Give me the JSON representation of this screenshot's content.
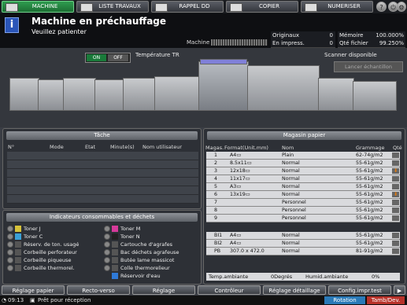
{
  "tabs": [
    {
      "label": "MACHINE",
      "icon": "machine-icon",
      "active": true
    },
    {
      "label": "LISTE TRAVAUX",
      "icon": "job-list-icon"
    },
    {
      "label": "RAPPEL DD",
      "icon": "hdd-recall-icon"
    },
    {
      "label": "COPIER",
      "icon": "copier-icon"
    },
    {
      "label": "NUMERISER",
      "icon": "scanner-icon"
    }
  ],
  "top_right": {
    "help": "?",
    "power": "⏻",
    "settings": "⚙"
  },
  "header": {
    "title": "Machine en préchauffage",
    "subtitle": "Veuillez patienter",
    "machine_label": "Machine",
    "stats": [
      {
        "label": "Originaux",
        "value": "0",
        "label2": "Mémoire",
        "value2": "100.000%"
      },
      {
        "label": "En impress.",
        "value": "0",
        "label2": "Qté fichier",
        "value2": "99.250%"
      }
    ]
  },
  "machine_area": {
    "on": "ON",
    "off": "OFF",
    "temp_label": "Température TR",
    "scanner_status": "Scanner disponible",
    "lancer_label": "Lancer échantillon"
  },
  "tache": {
    "title": "Tâche",
    "columns": [
      "N°",
      "Mode",
      "Etat",
      "Minute(s)",
      "Nom utilisateur"
    ]
  },
  "consumables": {
    "title": "Indicateurs consommables et déchets",
    "left": [
      "Toner J",
      "Toner C",
      "Réserv. de ton. usagé",
      "Corbeille perforateur",
      "Corbeille piqueuse",
      "Corbeille thermorel."
    ],
    "right": [
      "Toner M",
      "Toner N",
      "Cartouche d'agrafes",
      "Bac déchets agrafeuse",
      "Butée lame massicot",
      "Colle thermorelieur",
      "Réservoir d'eau"
    ]
  },
  "paper": {
    "title": "Magasin papier",
    "columns": [
      "Magas.",
      "Format(Unit.mm)",
      "Nom",
      "Grammage",
      "Qté"
    ],
    "trays": [
      {
        "num": "1",
        "format": "A4▭",
        "name": "Plain",
        "gram": "62-74g/m2",
        "alert": false
      },
      {
        "num": "2",
        "format": "8.5x11▭",
        "name": "Normal",
        "gram": "55-61g/m2",
        "alert": false
      },
      {
        "num": "3",
        "format": "12x18▭",
        "name": "Normal",
        "gram": "55-61g/m2",
        "alert": true
      },
      {
        "num": "4",
        "format": "11x17▭",
        "name": "Normal",
        "gram": "55-61g/m2",
        "alert": false
      },
      {
        "num": "5",
        "format": "A3▭",
        "name": "Normal",
        "gram": "55-61g/m2",
        "alert": false
      },
      {
        "num": "6",
        "format": "13x19▭",
        "name": "Normal",
        "gram": "55-61g/m2",
        "alert": true
      },
      {
        "num": "7",
        "format": "",
        "name": "Personnel",
        "gram": "55-61g/m2",
        "alert": false
      },
      {
        "num": "8",
        "format": "",
        "name": "Personnel",
        "gram": "55-61g/m2",
        "alert": false
      },
      {
        "num": "9",
        "format": "",
        "name": "Personnel",
        "gram": "55-61g/m2",
        "alert": false
      }
    ],
    "bypass": [
      {
        "num": "BI1",
        "format": "A4▭",
        "name": "Normal",
        "gram": "55-61g/m2"
      },
      {
        "num": "BI2",
        "format": "A4▭",
        "name": "Normal",
        "gram": "55-61g/m2"
      },
      {
        "num": "PB",
        "format": "307.0 x 472.0",
        "name": "Normal",
        "gram": "81-91g/m2"
      }
    ],
    "temp_label": "Temp.ambiante",
    "temp_value": "0Degrés",
    "hum_label": "Humid.ambiante",
    "hum_value": "0%"
  },
  "bottom_buttons": [
    "Réglage papier",
    "Recto-verso",
    "Réglage",
    "Contrôleur",
    "Réglage détaillage",
    "Config.impr.test"
  ],
  "status": {
    "time": "09:13",
    "message": "Prêt pour réception",
    "rotation": "Rotation",
    "tamb": "Tamb/Dev."
  }
}
